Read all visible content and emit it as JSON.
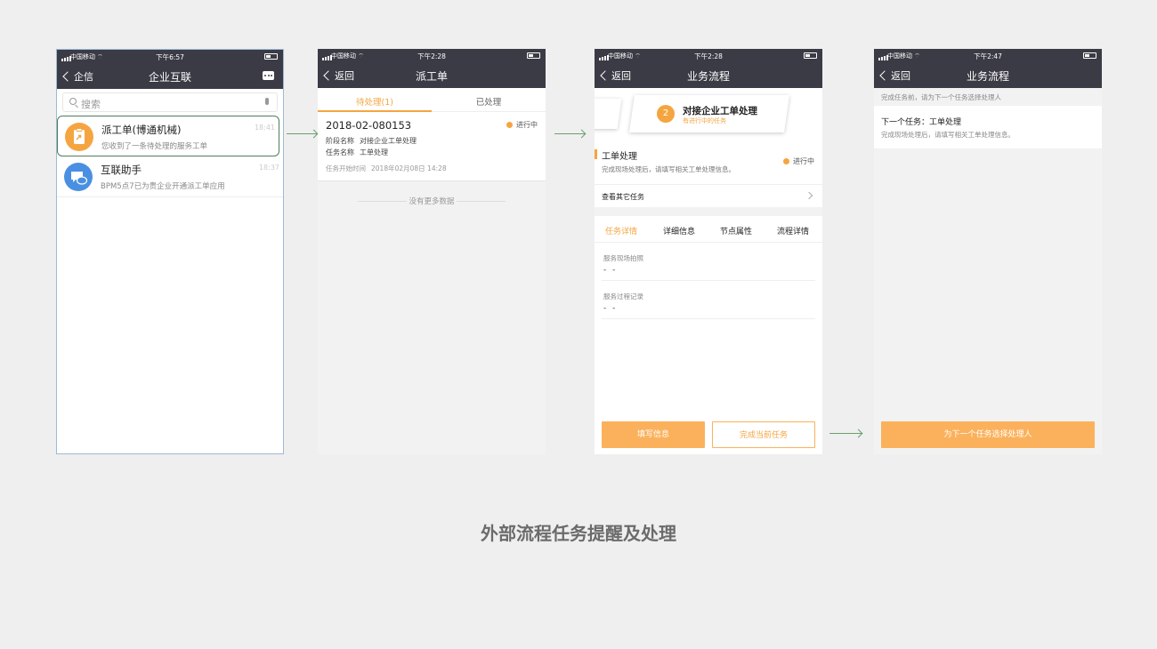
{
  "caption": "外部流程任务提醒及处理",
  "colors": {
    "nav_bg": "#3b3b46",
    "accent": "#f5a540",
    "button": "#fbb15b",
    "arrow": "#6aa06f"
  },
  "screen1": {
    "status": {
      "carrier": "中国移动",
      "time": "下午6:57"
    },
    "nav": {
      "back": "企信",
      "title": "企业互联",
      "right_icon": "chat-bubble-icon"
    },
    "search": {
      "placeholder": "搜索"
    },
    "conversations": [
      {
        "name": "派工单(博通机械)",
        "message": "您收到了一条待处理的服务工单",
        "time": "18:41",
        "icon": "clipboard-icon",
        "color": "#f5a540"
      },
      {
        "name": "互联助手",
        "message": "BPM5点7已为贵企业开通派工单应用",
        "time": "18:37",
        "icon": "chat-icon",
        "color": "#4a90e2"
      }
    ]
  },
  "screen2": {
    "status": {
      "carrier": "中国移动",
      "time": "下午2:28"
    },
    "nav": {
      "back": "返回",
      "title": "派工单"
    },
    "tabs": [
      "待处理(1)",
      "已处理"
    ],
    "card": {
      "number": "2018-02-080153",
      "status": "进行中",
      "stage_label": "阶段名称",
      "stage_value": "对接企业工单处理",
      "task_label": "任务名称",
      "task_value": "工单处理",
      "start_label": "任务开始时间",
      "start_value": "2018年02月08日 14:28"
    },
    "no_more": "没有更多数据"
  },
  "screen3": {
    "status": {
      "carrier": "中国移动",
      "time": "下午2:28"
    },
    "nav": {
      "back": "返回",
      "title": "业务流程"
    },
    "current_step": {
      "number": "2",
      "title": "对接企业工单处理",
      "subtitle": "有进行中的任务"
    },
    "task": {
      "title": "工单处理",
      "desc": "完成现场处理后，请填写相关工单处理信息。",
      "status": "进行中"
    },
    "other_tasks": "查看其它任务",
    "tabs": [
      "任务详情",
      "详细信息",
      "节点属性",
      "流程详情"
    ],
    "fields": [
      {
        "label": "服务现场拍照",
        "value": "- -"
      },
      {
        "label": "服务过程记录",
        "value": "- -"
      }
    ],
    "buttons": {
      "fill": "填写信息",
      "complete": "完成当前任务"
    }
  },
  "screen4": {
    "status": {
      "carrier": "中国移动",
      "time": "下午2:47"
    },
    "nav": {
      "back": "返回",
      "title": "业务流程"
    },
    "hint": "完成任务前，请为下一个任务选择处理人",
    "next_task": "下一个任务：工单处理",
    "next_desc": "完成现场处理后，请填写相关工单处理信息。",
    "button": "为下一个任务选择处理人"
  }
}
